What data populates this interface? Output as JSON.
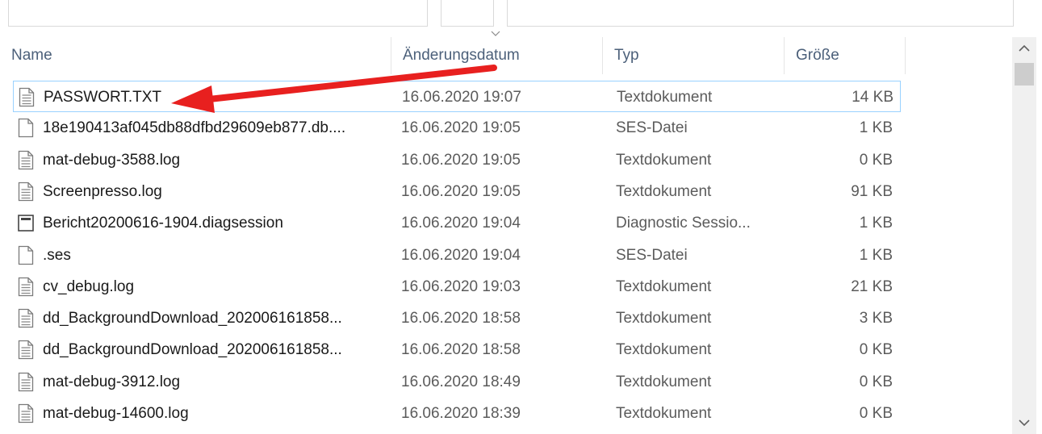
{
  "columns": {
    "name": "Name",
    "date": "Änderungsdatum",
    "type": "Typ",
    "size": "Größe"
  },
  "files": [
    {
      "name": "PASSWORT.TXT",
      "date": "16.06.2020 19:07",
      "type": "Textdokument",
      "size": "14 KB",
      "icon": "text-document-icon",
      "selected": true
    },
    {
      "name": "18e190413af045db88dfbd29609eb877.db....",
      "date": "16.06.2020 19:05",
      "type": "SES-Datei",
      "size": "1 KB",
      "icon": "blank-file-icon"
    },
    {
      "name": "mat-debug-3588.log",
      "date": "16.06.2020 19:05",
      "type": "Textdokument",
      "size": "0 KB",
      "icon": "text-document-icon"
    },
    {
      "name": "Screenpresso.log",
      "date": "16.06.2020 19:05",
      "type": "Textdokument",
      "size": "91 KB",
      "icon": "text-document-icon"
    },
    {
      "name": "Bericht20200616-1904.diagsession",
      "date": "16.06.2020 19:04",
      "type": "Diagnostic Sessio...",
      "size": "1 KB",
      "icon": "diagsession-file-icon"
    },
    {
      "name": ".ses",
      "date": "16.06.2020 19:04",
      "type": "SES-Datei",
      "size": "1 KB",
      "icon": "blank-file-icon"
    },
    {
      "name": "cv_debug.log",
      "date": "16.06.2020 19:03",
      "type": "Textdokument",
      "size": "21 KB",
      "icon": "text-document-icon"
    },
    {
      "name": "dd_BackgroundDownload_202006161858...",
      "date": "16.06.2020 18:58",
      "type": "Textdokument",
      "size": "3 KB",
      "icon": "text-document-icon"
    },
    {
      "name": "dd_BackgroundDownload_202006161858...",
      "date": "16.06.2020 18:58",
      "type": "Textdokument",
      "size": "0 KB",
      "icon": "text-document-icon"
    },
    {
      "name": "mat-debug-3912.log",
      "date": "16.06.2020 18:49",
      "type": "Textdokument",
      "size": "0 KB",
      "icon": "text-document-icon"
    },
    {
      "name": "mat-debug-14600.log",
      "date": "16.06.2020 18:39",
      "type": "Textdokument",
      "size": "0 KB",
      "icon": "text-document-icon"
    }
  ],
  "colors": {
    "header_text": "#4c607a",
    "selection_border": "#99d1ff",
    "annotation_arrow": "#e8201f"
  }
}
